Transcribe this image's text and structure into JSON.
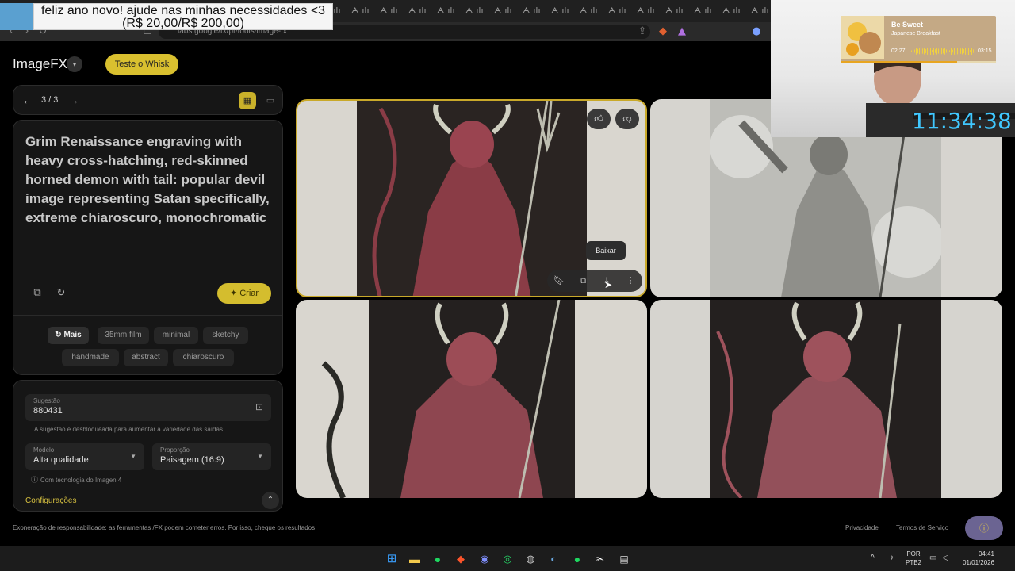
{
  "banner": {
    "text": "feliz ano novo! ajude nas minhas necessidades <3 (R$ 20,00/R$ 200,00)"
  },
  "browser": {
    "url": "labs.google/fx/pt/tools/image-fx",
    "tab_icon": "ᗅ ılı"
  },
  "app": {
    "title": "ImageFX",
    "whisk_button": "Teste o Whisk"
  },
  "pager": {
    "text": "3 / 3"
  },
  "prompt": {
    "text": "Grim Renaissance engraving with heavy cross-hatching, red-skinned horned demon with tail: popular devil image representing Satan specifically, extreme chiaroscuro, monochromatic",
    "create_button": "Criar"
  },
  "chips": {
    "more": "Mais",
    "items": [
      "35mm film",
      "minimal",
      "sketchy",
      "handmade",
      "abstract",
      "chiaroscuro"
    ]
  },
  "settings": {
    "seed_label": "Sugestão",
    "seed_value": "880431",
    "seed_hint": "A sugestão é desbloqueada para aumentar a variedade das saídas",
    "model_label": "Modelo",
    "model_value": "Alta qualidade",
    "ratio_label": "Proporção",
    "ratio_value": "Paisagem (16:9)",
    "powered_by": "Com tecnologia do Imagen 4",
    "config_label": "Configurações"
  },
  "image_tooltip": "Baixar",
  "footer": {
    "disclaimer": "Exoneração de responsabilidade: as ferramentas /FX podem cometer erros. Por isso, cheque os resultados",
    "privacy": "Privacidade",
    "terms": "Termos de Serviço"
  },
  "overlay": {
    "song_title": "Be Sweet",
    "song_artist": "Japanese Breakfast",
    "elapsed": "02:27",
    "total": "03:15",
    "progress": 0.75,
    "clock": "11:34:38"
  },
  "taskbar": {
    "lang_line1": "POR",
    "lang_line2": "PTB2",
    "time": "04:41",
    "date": "01/01/2026"
  },
  "colors": {
    "accent": "#d4bd2e",
    "clock": "#40c8ff"
  }
}
